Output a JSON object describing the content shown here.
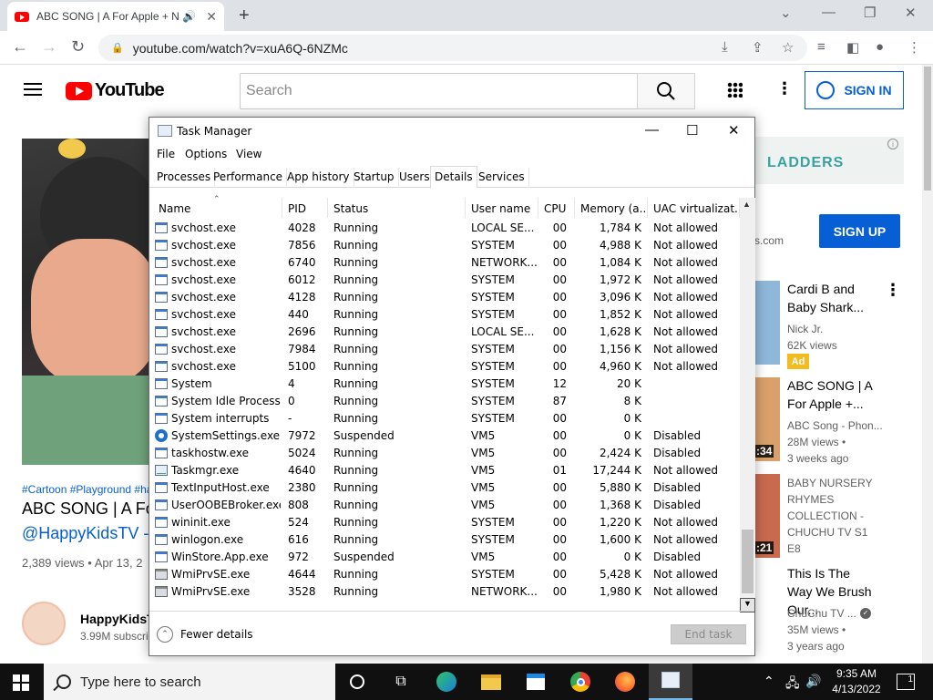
{
  "browser": {
    "tab_title": "ABC SONG | A For Apple + N",
    "url": "youtube.com/watch?v=xuA6Q-6NZMc"
  },
  "youtube": {
    "logo_text": "YouTube",
    "search_placeholder": "Search",
    "signin_label": "SIGN IN",
    "video_tags": "#Cartoon #Playground #ha",
    "video_title": "ABC SONG | A For",
    "video_channel_link": "@HappyKidsTV -",
    "video_meta": "2,389 views • Apr 13, 2",
    "channel_name": "HappyKidsT",
    "channel_subs": "3.99M subscri",
    "ad_brand": "LADDERS",
    "ad_domain": "s.com",
    "signup_label": "SIGN UP",
    "recommendations": [
      {
        "title": "Cardi B and Baby Shark...",
        "channel": "Nick Jr.",
        "views": "62K views",
        "badge": "Ad"
      },
      {
        "title": "ABC SONG | A For Apple +...",
        "channel": "ABC Song - Phon...",
        "views": "28M views •",
        "age": "3 weeks ago",
        "duration": ":34"
      },
      {
        "title": "BABY NURSERY RHYMES COLLECTION - CHUCHU TV S1 E8",
        "duration": ":21"
      },
      {
        "title": "This Is The Way We Brush Our...",
        "channel": "ChuChu TV ...",
        "views": "35M views •",
        "age": "3 years ago"
      }
    ]
  },
  "taskmanager": {
    "title": "Task Manager",
    "menu": [
      "File",
      "Options",
      "View"
    ],
    "tabs": [
      "Processes",
      "Performance",
      "App history",
      "Startup",
      "Users",
      "Details",
      "Services"
    ],
    "active_tab": "Details",
    "columns": [
      "Name",
      "PID",
      "Status",
      "User name",
      "CPU",
      "Memory (a...",
      "UAC virtualizat..."
    ],
    "rows": [
      {
        "name": "svchost.exe",
        "pid": "4028",
        "status": "Running",
        "user": "LOCAL SE...",
        "cpu": "00",
        "mem": "1,784 K",
        "uac": "Not allowed",
        "icon": "win"
      },
      {
        "name": "svchost.exe",
        "pid": "7856",
        "status": "Running",
        "user": "SYSTEM",
        "cpu": "00",
        "mem": "4,988 K",
        "uac": "Not allowed",
        "icon": "win"
      },
      {
        "name": "svchost.exe",
        "pid": "6740",
        "status": "Running",
        "user": "NETWORK...",
        "cpu": "00",
        "mem": "1,084 K",
        "uac": "Not allowed",
        "icon": "win"
      },
      {
        "name": "svchost.exe",
        "pid": "6012",
        "status": "Running",
        "user": "SYSTEM",
        "cpu": "00",
        "mem": "1,972 K",
        "uac": "Not allowed",
        "icon": "win"
      },
      {
        "name": "svchost.exe",
        "pid": "4128",
        "status": "Running",
        "user": "SYSTEM",
        "cpu": "00",
        "mem": "3,096 K",
        "uac": "Not allowed",
        "icon": "win"
      },
      {
        "name": "svchost.exe",
        "pid": "440",
        "status": "Running",
        "user": "SYSTEM",
        "cpu": "00",
        "mem": "1,852 K",
        "uac": "Not allowed",
        "icon": "win"
      },
      {
        "name": "svchost.exe",
        "pid": "2696",
        "status": "Running",
        "user": "LOCAL SE...",
        "cpu": "00",
        "mem": "1,628 K",
        "uac": "Not allowed",
        "icon": "win"
      },
      {
        "name": "svchost.exe",
        "pid": "7984",
        "status": "Running",
        "user": "SYSTEM",
        "cpu": "00",
        "mem": "1,156 K",
        "uac": "Not allowed",
        "icon": "win"
      },
      {
        "name": "svchost.exe",
        "pid": "5100",
        "status": "Running",
        "user": "SYSTEM",
        "cpu": "00",
        "mem": "4,960 K",
        "uac": "Not allowed",
        "icon": "win"
      },
      {
        "name": "System",
        "pid": "4",
        "status": "Running",
        "user": "SYSTEM",
        "cpu": "12",
        "mem": "20 K",
        "uac": "",
        "icon": "win"
      },
      {
        "name": "System Idle Process",
        "pid": "0",
        "status": "Running",
        "user": "SYSTEM",
        "cpu": "87",
        "mem": "8 K",
        "uac": "",
        "icon": "win"
      },
      {
        "name": "System interrupts",
        "pid": "-",
        "status": "Running",
        "user": "SYSTEM",
        "cpu": "00",
        "mem": "0 K",
        "uac": "",
        "icon": "win"
      },
      {
        "name": "SystemSettings.exe",
        "pid": "7972",
        "status": "Suspended",
        "user": "VM5",
        "cpu": "00",
        "mem": "0 K",
        "uac": "Disabled",
        "icon": "gear"
      },
      {
        "name": "taskhostw.exe",
        "pid": "5024",
        "status": "Running",
        "user": "VM5",
        "cpu": "00",
        "mem": "2,424 K",
        "uac": "Disabled",
        "icon": "win"
      },
      {
        "name": "Taskmgr.exe",
        "pid": "4640",
        "status": "Running",
        "user": "VM5",
        "cpu": "01",
        "mem": "17,244 K",
        "uac": "Not allowed",
        "icon": "graph"
      },
      {
        "name": "TextInputHost.exe",
        "pid": "2380",
        "status": "Running",
        "user": "VM5",
        "cpu": "00",
        "mem": "5,880 K",
        "uac": "Disabled",
        "icon": "win"
      },
      {
        "name": "UserOOBEBroker.exe",
        "pid": "808",
        "status": "Running",
        "user": "VM5",
        "cpu": "00",
        "mem": "1,368 K",
        "uac": "Disabled",
        "icon": "win"
      },
      {
        "name": "wininit.exe",
        "pid": "524",
        "status": "Running",
        "user": "SYSTEM",
        "cpu": "00",
        "mem": "1,220 K",
        "uac": "Not allowed",
        "icon": "win"
      },
      {
        "name": "winlogon.exe",
        "pid": "616",
        "status": "Running",
        "user": "SYSTEM",
        "cpu": "00",
        "mem": "1,600 K",
        "uac": "Not allowed",
        "icon": "win"
      },
      {
        "name": "WinStore.App.exe",
        "pid": "972",
        "status": "Suspended",
        "user": "VM5",
        "cpu": "00",
        "mem": "0 K",
        "uac": "Disabled",
        "icon": "win"
      },
      {
        "name": "WmiPrvSE.exe",
        "pid": "4644",
        "status": "Running",
        "user": "SYSTEM",
        "cpu": "00",
        "mem": "5,428 K",
        "uac": "Not allowed",
        "icon": "wmi"
      },
      {
        "name": "WmiPrvSE.exe",
        "pid": "3528",
        "status": "Running",
        "user": "NETWORK...",
        "cpu": "00",
        "mem": "1,980 K",
        "uac": "Not allowed",
        "icon": "wmi"
      }
    ],
    "fewer_details_label": "Fewer details",
    "end_task_label": "End task"
  },
  "taskbar": {
    "search_placeholder": "Type here to search",
    "time": "9:35 AM",
    "date": "4/13/2022",
    "notification_count": "1"
  }
}
